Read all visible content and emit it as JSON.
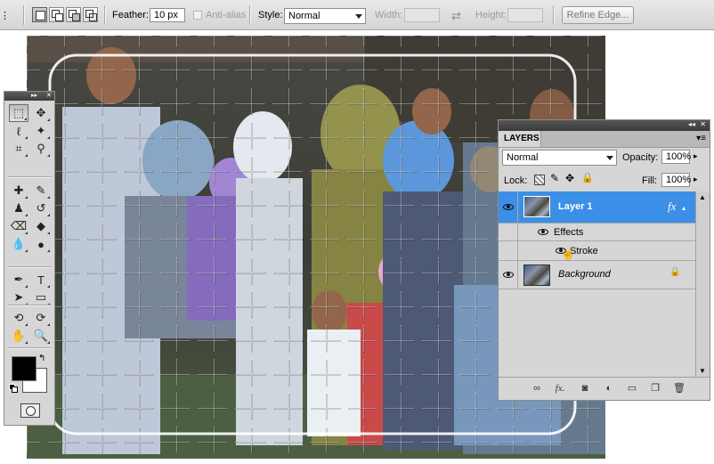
{
  "options_bar": {
    "feather_label": "Feather:",
    "feather_value": "10 px",
    "antialias_label": "Anti-alias",
    "style_label": "Style:",
    "style_value": "Normal",
    "width_label": "Width:",
    "height_label": "Height:",
    "refine_edge_label": "Refine Edge..."
  },
  "canvas": {
    "description_icons": [
      "jigsaw-texture"
    ]
  },
  "tools_palette": {
    "header_glyph": "▸▸",
    "close_glyph": "✕",
    "tools": [
      {
        "name": "rectangular-marquee-tool",
        "glyph": "⬚"
      },
      {
        "name": "move-tool",
        "glyph": "✥"
      },
      {
        "name": "lasso-tool",
        "glyph": "ℓ"
      },
      {
        "name": "magic-wand-tool",
        "glyph": "✦"
      },
      {
        "name": "crop-tool",
        "glyph": "⌗"
      },
      {
        "name": "eyedropper-tool",
        "glyph": "⚲"
      },
      {
        "name": "healing-brush-tool",
        "glyph": "✚"
      },
      {
        "name": "brush-tool",
        "glyph": "✎"
      },
      {
        "name": "clone-stamp-tool",
        "glyph": "♟"
      },
      {
        "name": "history-brush-tool",
        "glyph": "↺"
      },
      {
        "name": "eraser-tool",
        "glyph": "⌫"
      },
      {
        "name": "paint-bucket-tool",
        "glyph": "◆"
      },
      {
        "name": "blur-tool",
        "glyph": "💧"
      },
      {
        "name": "dodge-tool",
        "glyph": "●"
      },
      {
        "name": "pen-tool",
        "glyph": "✒"
      },
      {
        "name": "type-tool",
        "glyph": "T"
      },
      {
        "name": "path-selection-tool",
        "glyph": "➤"
      },
      {
        "name": "rectangle-shape-tool",
        "glyph": "▭"
      },
      {
        "name": "3d-rotate-tool",
        "glyph": "⟲"
      },
      {
        "name": "3d-orbit-tool",
        "glyph": "⟳"
      },
      {
        "name": "hand-tool",
        "glyph": "✋"
      },
      {
        "name": "zoom-tool",
        "glyph": "🔍"
      }
    ],
    "foreground_color": "#000000",
    "background_color": "#ffffff"
  },
  "layers_panel": {
    "title": "LAYERS",
    "blend_mode": "Normal",
    "opacity_label": "Opacity:",
    "opacity_value": "100%",
    "lock_label": "Lock:",
    "fill_label": "Fill:",
    "fill_value": "100%",
    "layers": [
      {
        "name": "Layer 1",
        "selected": true,
        "fx": "fx"
      },
      {
        "name": "Effects"
      },
      {
        "name": "Stroke"
      },
      {
        "name": "Background",
        "locked": true
      }
    ],
    "bottom_icons": [
      "link-icon",
      "fx-icon",
      "mask-icon",
      "adjustment-icon",
      "group-icon",
      "new-layer-icon",
      "delete-icon"
    ],
    "selected_color": "#3b8fe6"
  }
}
